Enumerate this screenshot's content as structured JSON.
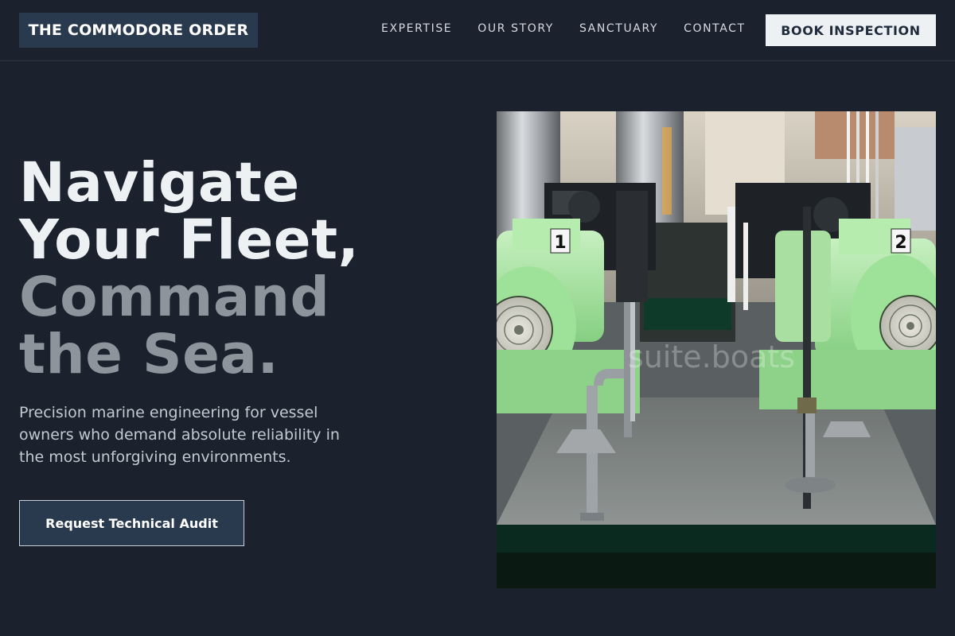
{
  "header": {
    "logo": "THE COMMODORE ORDER",
    "nav": [
      "EXPERTISE",
      "OUR STORY",
      "SANCTUARY",
      "CONTACT"
    ],
    "cta": "BOOK INSPECTION"
  },
  "hero": {
    "headline_line1": "Navigate",
    "headline_line2": "Your Fleet,",
    "headline_line3": "Command",
    "headline_line4": "the Sea.",
    "subtext": "Precision marine engineering for vessel owners who demand absolute reliability in the most unforgiving environments.",
    "button": "Request Technical Audit"
  },
  "image": {
    "motor_1_label": "1",
    "motor_2_label": "2",
    "watermark": "suite.boats"
  },
  "colors": {
    "background": "#1b222d",
    "accent_panel": "#2a3a4e",
    "headline_light": "#eef1f4",
    "headline_muted": "#8d949c",
    "motor_green": "#a8e6a2"
  }
}
